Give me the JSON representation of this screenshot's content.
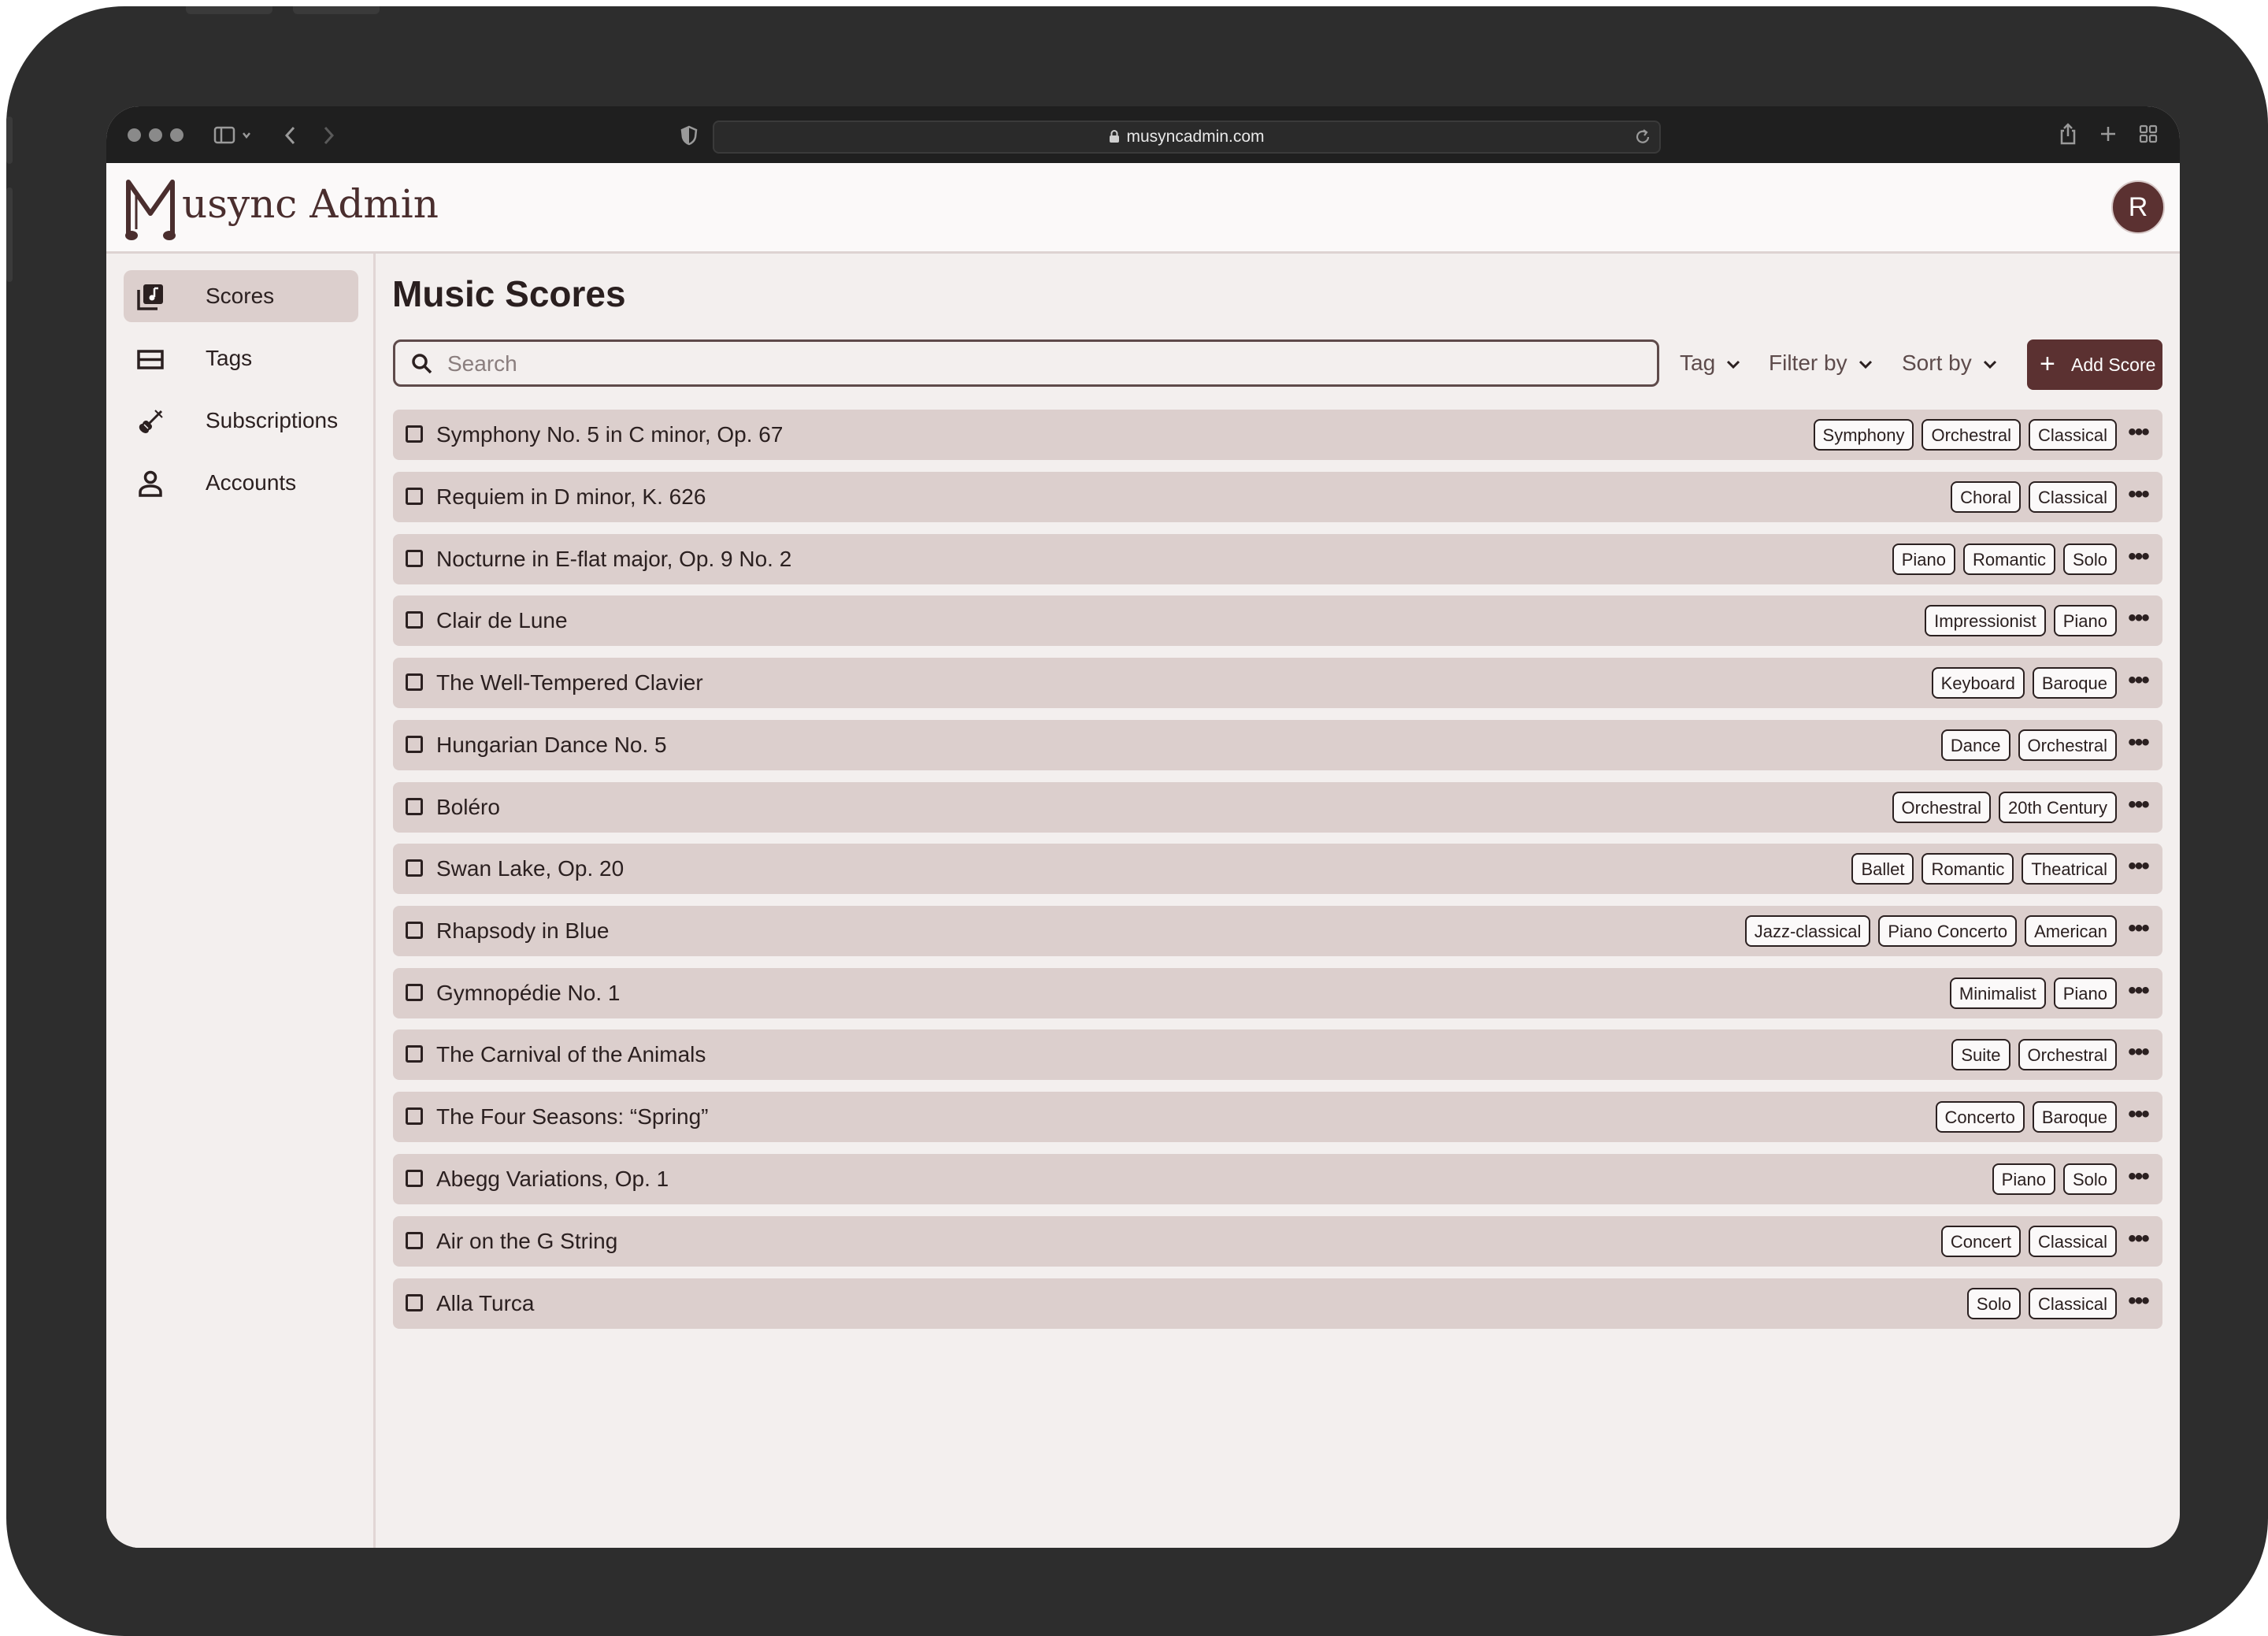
{
  "browser": {
    "url": "musyncadmin.com"
  },
  "app": {
    "name": "usync Admin",
    "user_initial": "R"
  },
  "sidebar": {
    "items": [
      {
        "label": "Scores",
        "icon": "scores-icon",
        "active": true
      },
      {
        "label": "Tags",
        "icon": "tags-icon",
        "active": false
      },
      {
        "label": "Subscriptions",
        "icon": "violin-icon",
        "active": false
      },
      {
        "label": "Accounts",
        "icon": "person-icon",
        "active": false
      }
    ]
  },
  "main": {
    "title": "Music Scores",
    "search_placeholder": "Search",
    "filters": {
      "tag": "Tag",
      "filter_by": "Filter by",
      "sort_by": "Sort by"
    },
    "add_button": "Add Score",
    "scores": [
      {
        "title": "Symphony No. 5 in C minor, Op. 67",
        "tags": [
          "Symphony",
          "Orchestral",
          "Classical"
        ]
      },
      {
        "title": "Requiem in D minor, K. 626",
        "tags": [
          "Choral",
          "Classical"
        ]
      },
      {
        "title": "Nocturne in E-flat major, Op. 9 No. 2",
        "tags": [
          "Piano",
          "Romantic",
          "Solo"
        ]
      },
      {
        "title": "Clair de Lune",
        "tags": [
          "Impressionist",
          "Piano"
        ]
      },
      {
        "title": "The Well-Tempered Clavier",
        "tags": [
          "Keyboard",
          "Baroque"
        ]
      },
      {
        "title": "Hungarian Dance No. 5",
        "tags": [
          "Dance",
          "Orchestral"
        ]
      },
      {
        "title": "Boléro",
        "tags": [
          "Orchestral",
          "20th Century"
        ]
      },
      {
        "title": "Swan Lake, Op. 20",
        "tags": [
          "Ballet",
          "Romantic",
          "Theatrical"
        ]
      },
      {
        "title": "Rhapsody in Blue",
        "tags": [
          "Jazz-classical",
          "Piano Concerto",
          "American"
        ]
      },
      {
        "title": "Gymnopédie No. 1",
        "tags": [
          "Minimalist",
          "Piano"
        ]
      },
      {
        "title": "The Carnival of the Animals",
        "tags": [
          "Suite",
          "Orchestral"
        ]
      },
      {
        "title": "The Four Seasons: “Spring”",
        "tags": [
          "Concerto",
          "Baroque"
        ]
      },
      {
        "title": "Abegg Variations, Op. 1",
        "tags": [
          "Piano",
          "Solo"
        ]
      },
      {
        "title": "Air on the G String",
        "tags": [
          "Concert",
          "Classical"
        ]
      },
      {
        "title": "Alla Turca",
        "tags": [
          "Solo",
          "Classical"
        ]
      }
    ]
  },
  "colors": {
    "brand": "#5b3131",
    "row_bg": "#dccfcd",
    "page_bg": "#f3efee"
  }
}
